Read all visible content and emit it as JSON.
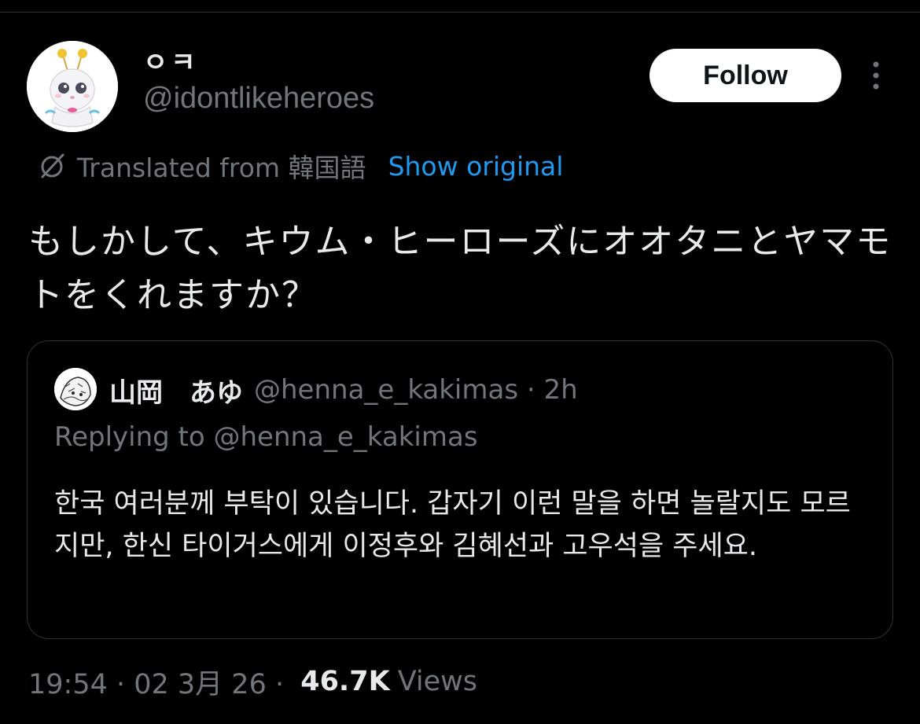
{
  "author": {
    "display_name": "ㅇㅋ",
    "handle": "@idontlikeheroes",
    "avatar_icon": "white-character-avatar-icon"
  },
  "actions": {
    "follow_label": "Follow",
    "more_icon": "more-vertical-icon"
  },
  "translation": {
    "icon": "translate-icon",
    "translated_from": "Translated from 韓国語",
    "show_original": "Show original"
  },
  "tweet": {
    "text": "もしかして、キウム・ヒーローズにオオタニとヤマモトをくれますか？"
  },
  "quote": {
    "display_name": "山岡　あゆ",
    "meta": "@henna_e_kakimas · 2h",
    "replying_to": "Replying to @henna_e_kakimas",
    "text": "한국 여러분께 부탁이 있습니다. 갑자기 이런 말을 하면 놀랄지도 모르지만, 한신 타이거스에게 이정후와 김혜선과 고우석을 주세요.",
    "avatar_icon": "manga-drawing-avatar-icon"
  },
  "meta": {
    "time_date": "19:54 · 02 3月 26 · ",
    "views_count": "46.7K",
    "views_label": "Views"
  },
  "colors": {
    "background": "#000000",
    "text": "#e7e9ea",
    "secondary": "#71767b",
    "link": "#1d9bf0",
    "border": "#2f3336"
  }
}
